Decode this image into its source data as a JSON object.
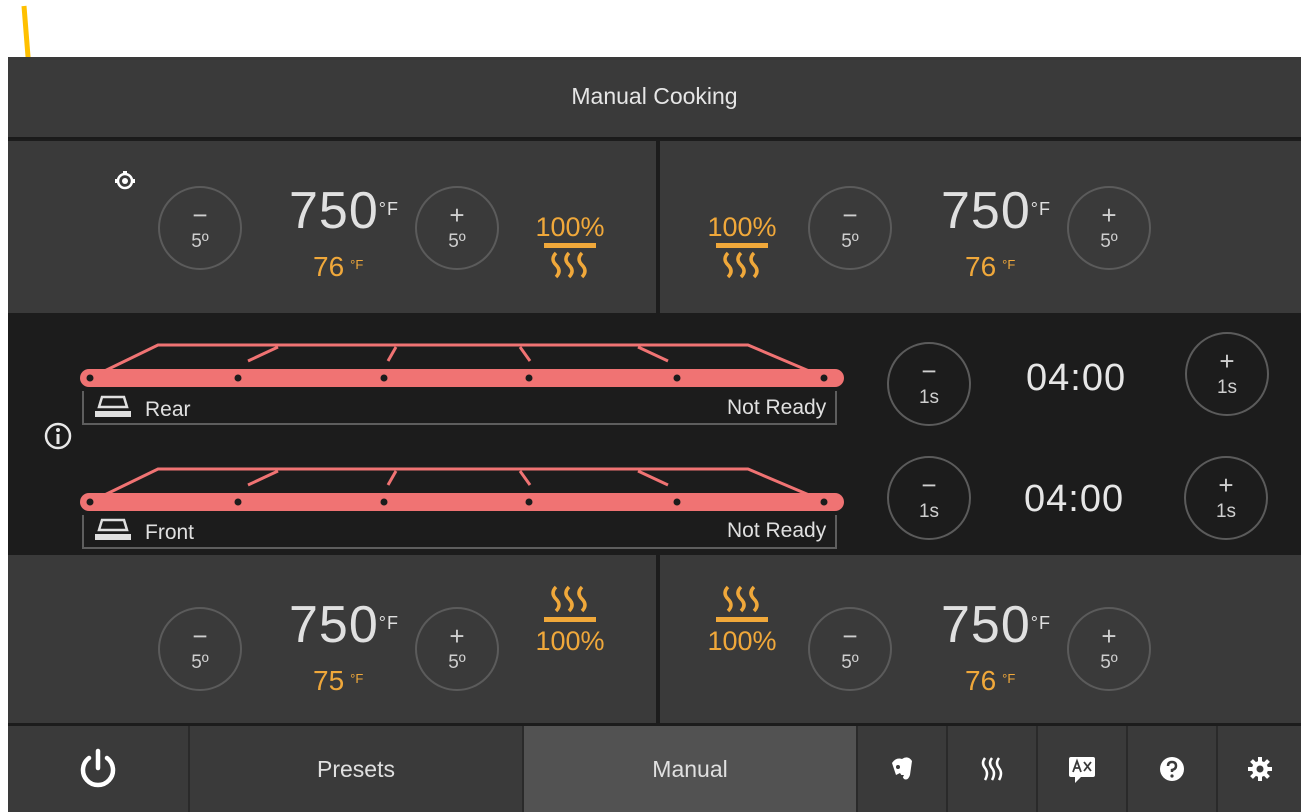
{
  "header": {
    "title": "Manual Cooking"
  },
  "zones": {
    "top_left": {
      "setpoint": "750",
      "unit": "°F",
      "actual": "76",
      "actual_unit": "°F",
      "heater_pct": "100%",
      "minus": "−",
      "plus": "+",
      "step": "5º"
    },
    "top_right": {
      "setpoint": "750",
      "unit": "°F",
      "actual": "76",
      "actual_unit": "°F",
      "heater_pct": "100%",
      "minus": "−",
      "plus": "+",
      "step": "5º"
    },
    "bottom_left": {
      "setpoint": "750",
      "unit": "°F",
      "actual": "75",
      "actual_unit": "°F",
      "heater_pct": "100%",
      "minus": "−",
      "plus": "+",
      "step": "5º"
    },
    "bottom_right": {
      "setpoint": "750",
      "unit": "°F",
      "actual": "76",
      "actual_unit": "°F",
      "heater_pct": "100%",
      "minus": "−",
      "plus": "+",
      "step": "5º"
    }
  },
  "conveyors": {
    "rear": {
      "label": "Rear",
      "status": "Not Ready",
      "time": "04:00",
      "minus": "−",
      "plus": "+",
      "step": "1s"
    },
    "front": {
      "label": "Front",
      "status": "Not Ready",
      "time": "04:00",
      "minus": "−",
      "plus": "+",
      "step": "1s"
    }
  },
  "nav": {
    "presets": "Presets",
    "manual": "Manual"
  },
  "colors": {
    "accent_orange": "#f0a83a",
    "belt_red": "#f07373",
    "panel": "#3a3a3a",
    "background": "#1c1c1c",
    "arrow": "#ffc000"
  },
  "icons": {
    "info": "info-icon",
    "power": "power-icon",
    "clean": "cleaning-icon",
    "heat": "heat-icon",
    "language": "language-icon",
    "help": "help-icon",
    "settings": "gear-icon",
    "crust": "crust-icon",
    "conveyor": "conveyor-icon"
  }
}
